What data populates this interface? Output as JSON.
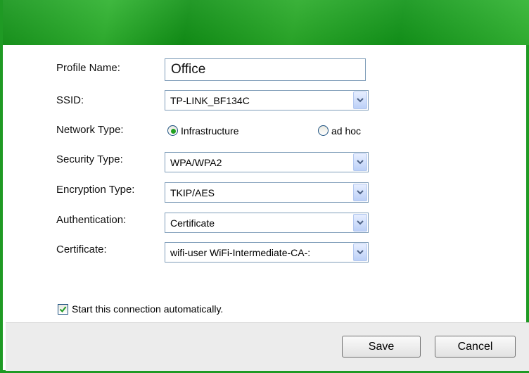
{
  "form": {
    "profile_name_label": "Profile Name:",
    "profile_name_value": "Office",
    "ssid_label": "SSID:",
    "ssid_value": "TP-LINK_BF134C",
    "network_type_label": "Network Type:",
    "network_type_options": [
      "Infrastructure",
      "ad hoc"
    ],
    "network_type_selected": "Infrastructure",
    "security_type_label": "Security Type:",
    "security_type_value": "WPA/WPA2",
    "encryption_type_label": "Encryption Type:",
    "encryption_type_value": "TKIP/AES",
    "authentication_label": "Authentication:",
    "authentication_value": "Certificate",
    "certificate_label": "Certificate:",
    "certificate_value": "wifi-user  WiFi-Intermediate-CA-:"
  },
  "auto_connect": {
    "label": "Start this connection automatically.",
    "checked": true
  },
  "footer": {
    "save_label": "Save",
    "cancel_label": "Cancel"
  },
  "colors": {
    "header_green": "#1f9a24",
    "radio_dot": "#21a121",
    "check_mark": "#1f9a24"
  },
  "icons": {
    "combo": "chevron-down-icon",
    "check": "check-icon"
  }
}
